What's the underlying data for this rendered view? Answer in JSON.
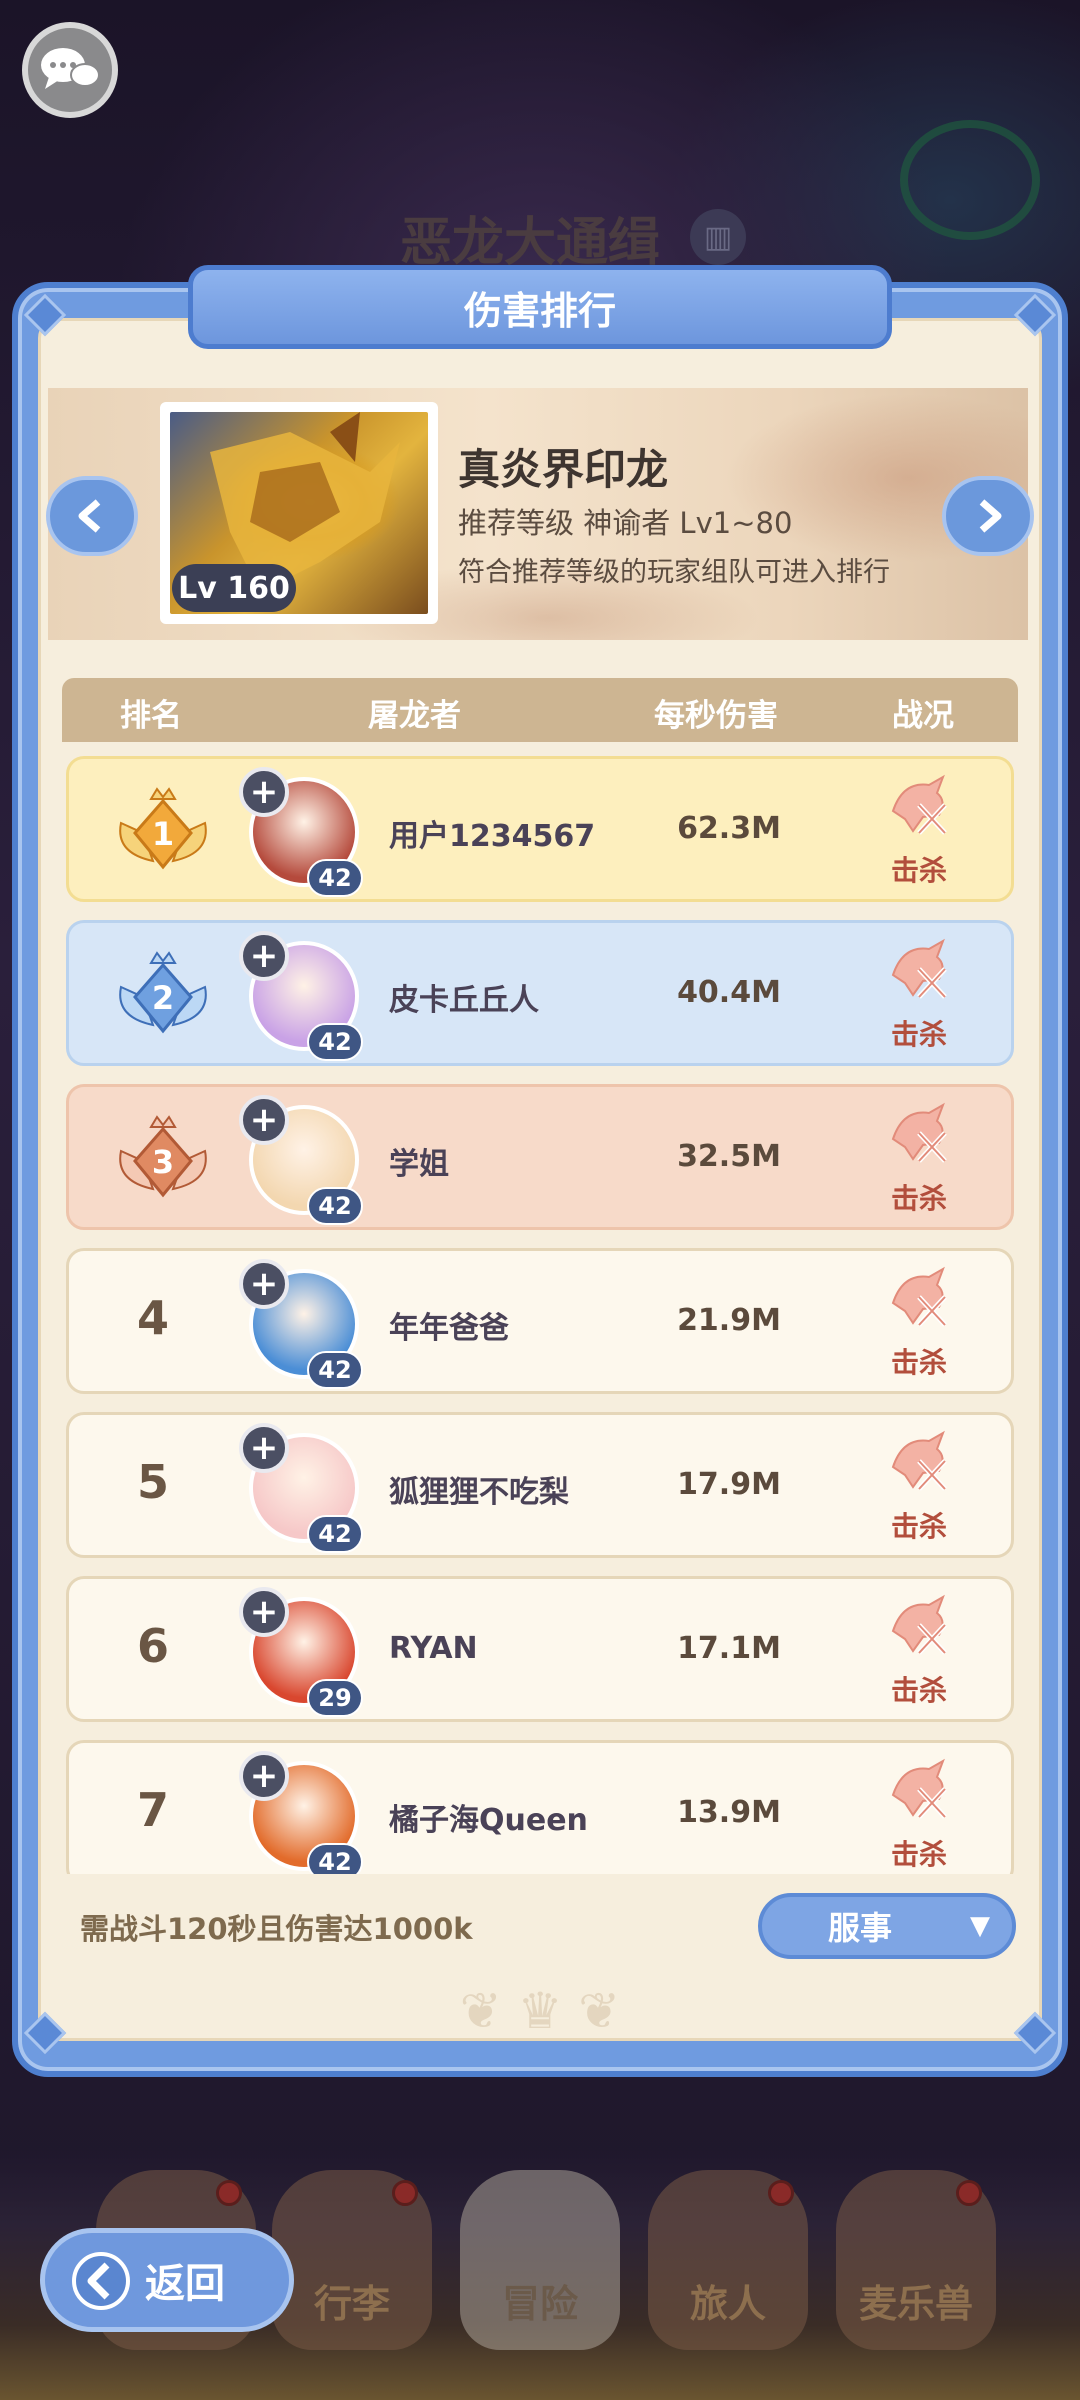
{
  "event": {
    "title": "恶龙大通缉"
  },
  "panel": {
    "title": "伤害排行"
  },
  "boss": {
    "name": "真炎界印龙",
    "level_badge": "Lv 160",
    "recommend": "推荐等级 神谕者 Lv1~80",
    "note": "符合推荐等级的玩家组队可进入排行"
  },
  "table": {
    "headers": {
      "rank": "排名",
      "slayer": "屠龙者",
      "dps": "每秒伤害",
      "status": "战况"
    },
    "rows": [
      {
        "rank": "1",
        "name": "用户1234567",
        "level": "42",
        "dps": "62.3M",
        "status": "击杀"
      },
      {
        "rank": "2",
        "name": "皮卡丘丘人",
        "level": "42",
        "dps": "40.4M",
        "status": "击杀"
      },
      {
        "rank": "3",
        "name": "学姐",
        "level": "42",
        "dps": "32.5M",
        "status": "击杀"
      },
      {
        "rank": "4",
        "name": "年年爸爸",
        "level": "42",
        "dps": "21.9M",
        "status": "击杀"
      },
      {
        "rank": "5",
        "name": "狐狸狸不吃梨",
        "level": "42",
        "dps": "17.9M",
        "status": "击杀"
      },
      {
        "rank": "6",
        "name": "RYAN",
        "level": "29",
        "dps": "17.1M",
        "status": "击杀"
      },
      {
        "rank": "7",
        "name": "橘子海Queen",
        "level": "42",
        "dps": "13.9M",
        "status": "击杀"
      }
    ]
  },
  "footer": {
    "requirement": "需战斗120秒且伤害达1000k",
    "server_button": "服事"
  },
  "bottom_nav": {
    "back": "返回",
    "tabs": [
      "行李",
      "冒险",
      "旅人",
      "麦乐兽"
    ]
  },
  "colors": {
    "panel_blue": "#6f9be0",
    "gold_row": "#fdefbe",
    "silver_row": "#d7e6f7",
    "bronze_row": "#f7dac9",
    "kill_red": "#b24e3c"
  }
}
